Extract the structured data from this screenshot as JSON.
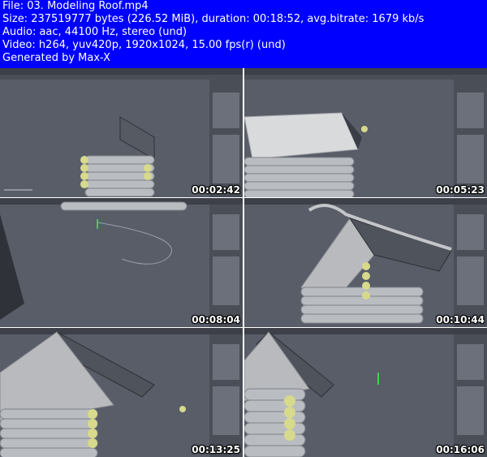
{
  "header": {
    "line1": "File: 03. Modeling Roof.mp4",
    "line2": "Size: 237519777 bytes (226.52 MiB), duration: 00:18:52, avg.bitrate: 1679 kb/s",
    "line3": "Audio: aac, 44100 Hz, stereo (und)",
    "line4": "Video: h264, yuv420p, 1920x1024, 15.00 fps(r) (und)",
    "line5": "Generated by Max-X"
  },
  "thumbnails": [
    {
      "timestamp": "00:02:42",
      "scene": "roof-panel-open"
    },
    {
      "timestamp": "00:05:23",
      "scene": "roof-closed"
    },
    {
      "timestamp": "00:08:04",
      "scene": "cylinder-spline"
    },
    {
      "timestamp": "00:10:44",
      "scene": "roof-gutter"
    },
    {
      "timestamp": "00:13:25",
      "scene": "cabin-front"
    },
    {
      "timestamp": "00:16:06",
      "scene": "cabin-close"
    }
  ],
  "colors": {
    "header_bg": "#0000ff",
    "header_text": "#ffffff",
    "viewport_bg": "#585d68",
    "panel_bg": "#4a4e57",
    "log_color": "#c9ccce",
    "log_end": "#d7d98c"
  }
}
